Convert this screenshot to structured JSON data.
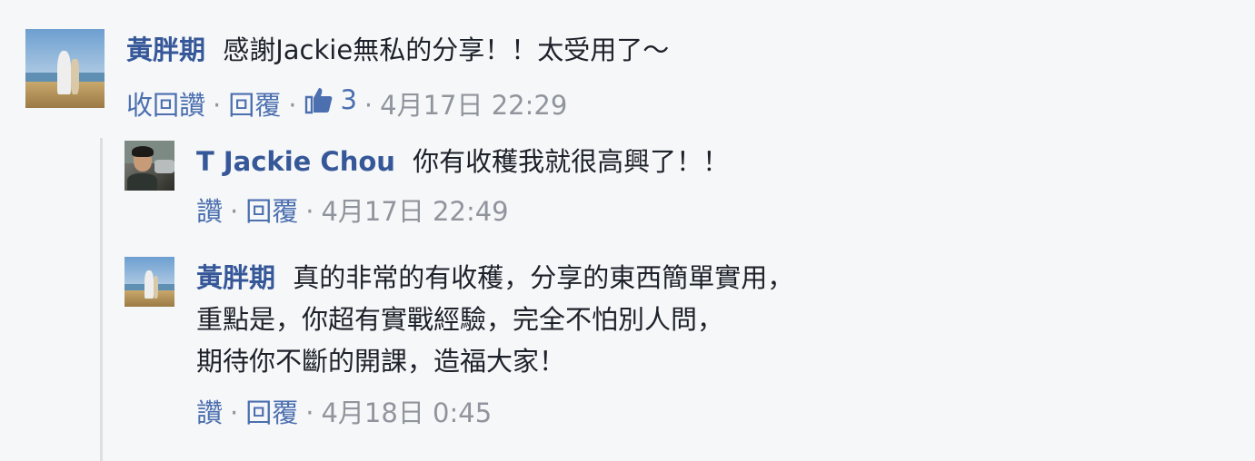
{
  "comments": [
    {
      "author": "黃胖期",
      "text_lines": [
        "感謝Jackie無私的分享！！太受用了～"
      ],
      "actions": {
        "like": "收回讚",
        "reply": "回覆",
        "like_count": "3",
        "time": "4月17日 22:29"
      }
    },
    {
      "author": "T Jackie Chou",
      "text_lines": [
        "你有收穫我就很高興了！！"
      ],
      "actions": {
        "like": "讚",
        "reply": "回覆",
        "time": "4月17日 22:49"
      }
    },
    {
      "author": "黃胖期",
      "text_lines": [
        "真的非常的有收穫，分享的東西簡單實用，",
        "重點是，你超有實戰經驗，完全不怕別人問，",
        "期待你不斷的開課，造福大家！"
      ],
      "actions": {
        "like": "讚",
        "reply": "回覆",
        "time": "4月18日 0:45"
      }
    }
  ],
  "separator": "·",
  "colors": {
    "author": "#365899",
    "meta": "#90949c",
    "link": "#4b6faf",
    "background": "#f6f7f9"
  },
  "icons": {
    "like": "thumbs-up-icon"
  }
}
